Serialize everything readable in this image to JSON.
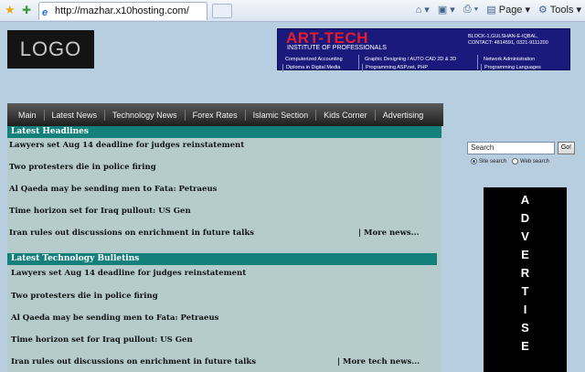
{
  "browser": {
    "url": "http://mazhar.x10hosting.com/",
    "menu": {
      "page_label": "Page",
      "tools_label": "Tools"
    }
  },
  "header": {
    "logo_text": "LOGO",
    "banner": {
      "title": "ART-TECH",
      "subtitle": "INSTITUTE OF PROFESSIONALS",
      "address_line1": "BLOCK-1,GULSHAN-E-IQBAL,",
      "address_line2": "CONTACT: 4814591, 0321-9111200",
      "courses": [
        {
          "line1": "Computerized Accounting",
          "line2": "Diploma in Digital Media"
        },
        {
          "line1": "Graphic Designing / AUTO CAD 2D & 3D",
          "line2": "Programming ASP.net, PHP"
        },
        {
          "line1": "Network Administration",
          "line2": "Programming Languages"
        }
      ]
    }
  },
  "nav": {
    "items": [
      "Main",
      "Latest News",
      "Technology News",
      "Forex Rates",
      "Islamic Section",
      "Kids Corner",
      "Advertising"
    ]
  },
  "latest_headlines": {
    "title": "Latest Headlines",
    "items": [
      "Lawyers set Aug 14 deadline for judges reinstatement",
      "Two protesters die in police firing",
      "Al Qaeda may be sending men to Fata: Petraeus",
      "Time horizon set for Iraq pullout: US Gen",
      "Iran rules out discussions on enrichment in future talks"
    ],
    "more": "| More news..."
  },
  "tech_bulletins": {
    "title": "Latest Technology Bulletins",
    "items": [
      "Lawyers set Aug 14 deadline for judges reinstatement",
      "Two protesters die in police firing",
      "Al Qaeda may be sending men to Fata: Petraeus",
      "Time horizon set for Iraq pullout: US Gen",
      "Iran rules out discussions on enrichment in future talks"
    ],
    "more": "| More tech news..."
  },
  "search": {
    "value": "Search",
    "button": "Go!",
    "options": [
      "Site search",
      "Web search"
    ],
    "selected": "Site search"
  },
  "advertise": {
    "letters": [
      "A",
      "D",
      "V",
      "E",
      "R",
      "T",
      "I",
      "S",
      "E"
    ]
  }
}
